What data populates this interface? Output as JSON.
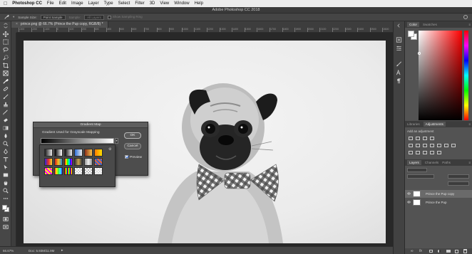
{
  "menubar": {
    "app_name": "Photoshop CC",
    "items": [
      "File",
      "Edit",
      "Image",
      "Layer",
      "Type",
      "Select",
      "Filter",
      "3D",
      "View",
      "Window",
      "Help"
    ]
  },
  "window": {
    "title": "Adobe Photoshop CC 2018"
  },
  "options_bar": {
    "sample_size_label": "Sample Size:",
    "sample_size_value": "Point Sample",
    "sample_label": "Sample:",
    "sample_value": "All Layers",
    "show_ring_label": "Show Sampling Ring"
  },
  "document": {
    "tab_label": "prince.png @ 66.7% (Prince the Pup copy, RGB/8) *"
  },
  "ruler_ticks": [
    "-300",
    "-200",
    "-100",
    "0",
    "100",
    "200",
    "300",
    "400",
    "500",
    "600",
    "700",
    "800",
    "900",
    "1000",
    "1100",
    "1200",
    "1300",
    "1400",
    "1500",
    "1600",
    "1700",
    "1800",
    "1900",
    "2000",
    "2100",
    "2200",
    "2300",
    "2400",
    "2500",
    "2600"
  ],
  "status_bar": {
    "zoom": "66.67%",
    "doc_size": "Doc: 5.93M/11.9M"
  },
  "color_panel": {
    "tabs": [
      "Color",
      "Swatches"
    ],
    "active_tab": "Color"
  },
  "adjustments_panel": {
    "tabs": [
      "Libraries",
      "Adjustments"
    ],
    "active_tab": "Adjustments",
    "add_label": "Add an adjustment"
  },
  "layers_panel": {
    "tabs": [
      "Layers",
      "Channels",
      "Paths"
    ],
    "active_tab": "Layers",
    "layers": [
      {
        "name": "Prince the Pup copy",
        "selected": true
      },
      {
        "name": "Prince the Pup",
        "selected": false
      }
    ]
  },
  "gradient_map_dialog": {
    "title": "Gradient Map",
    "group_label": "Gradient Used for Grayscale Mapping",
    "ok_label": "OK",
    "cancel_label": "Cancel",
    "preview_label": "Preview",
    "preview_checked": true
  },
  "gradient_presets": [
    "linear-gradient(to right,#1c1c1c,#e8e8e8)",
    "linear-gradient(to right,#000,#fff)",
    "linear-gradient(to right,#111,#eee)",
    "linear-gradient(to right,#2e6fd8,#eee)",
    "linear-gradient(to right,#8b2f1a,#f7c24c)",
    "linear-gradient(to right,#ff7a00,#ffe000)",
    "linear-gradient(to right,#2a2adb,#e82b2b,#f3e02e)",
    "linear-gradient(to right,#d81b1b,#f4c21f,#2b8bd8)",
    "linear-gradient(to right,#ff0000,#ff0,#0f0,#0ff,#00f,#f0f)",
    "linear-gradient(to right,#3a3a3a,#c9a34f,#3a3a3a)",
    "linear-gradient(to right,#999,#eee,#999)",
    "repeating-linear-gradient(45deg,#e63,#e63 2px,#36c 2px,#36c 4px)",
    "repeating-linear-gradient(45deg,#ff0,#ff0 2px,#f0f 2px,#f0f 4px)",
    "linear-gradient(to right,#f33,#ff0,#3f3,#3ff,#33f)",
    "repeating-linear-gradient(90deg,#f00 0 1px,#ff0 1px 2px,#0f0 2px 3px,#00f 3px 4px)",
    "repeating-conic-gradient(#ccc 0 25%,#fff 0 50%) 0 0/4px 4px",
    "repeating-conic-gradient(#bbb 0 25%,#fff 0 50%) 0 0/4px 4px",
    "repeating-conic-gradient(#ddd 0 25%,#f6f6f6 0 50%) 0 0/4px 4px"
  ]
}
